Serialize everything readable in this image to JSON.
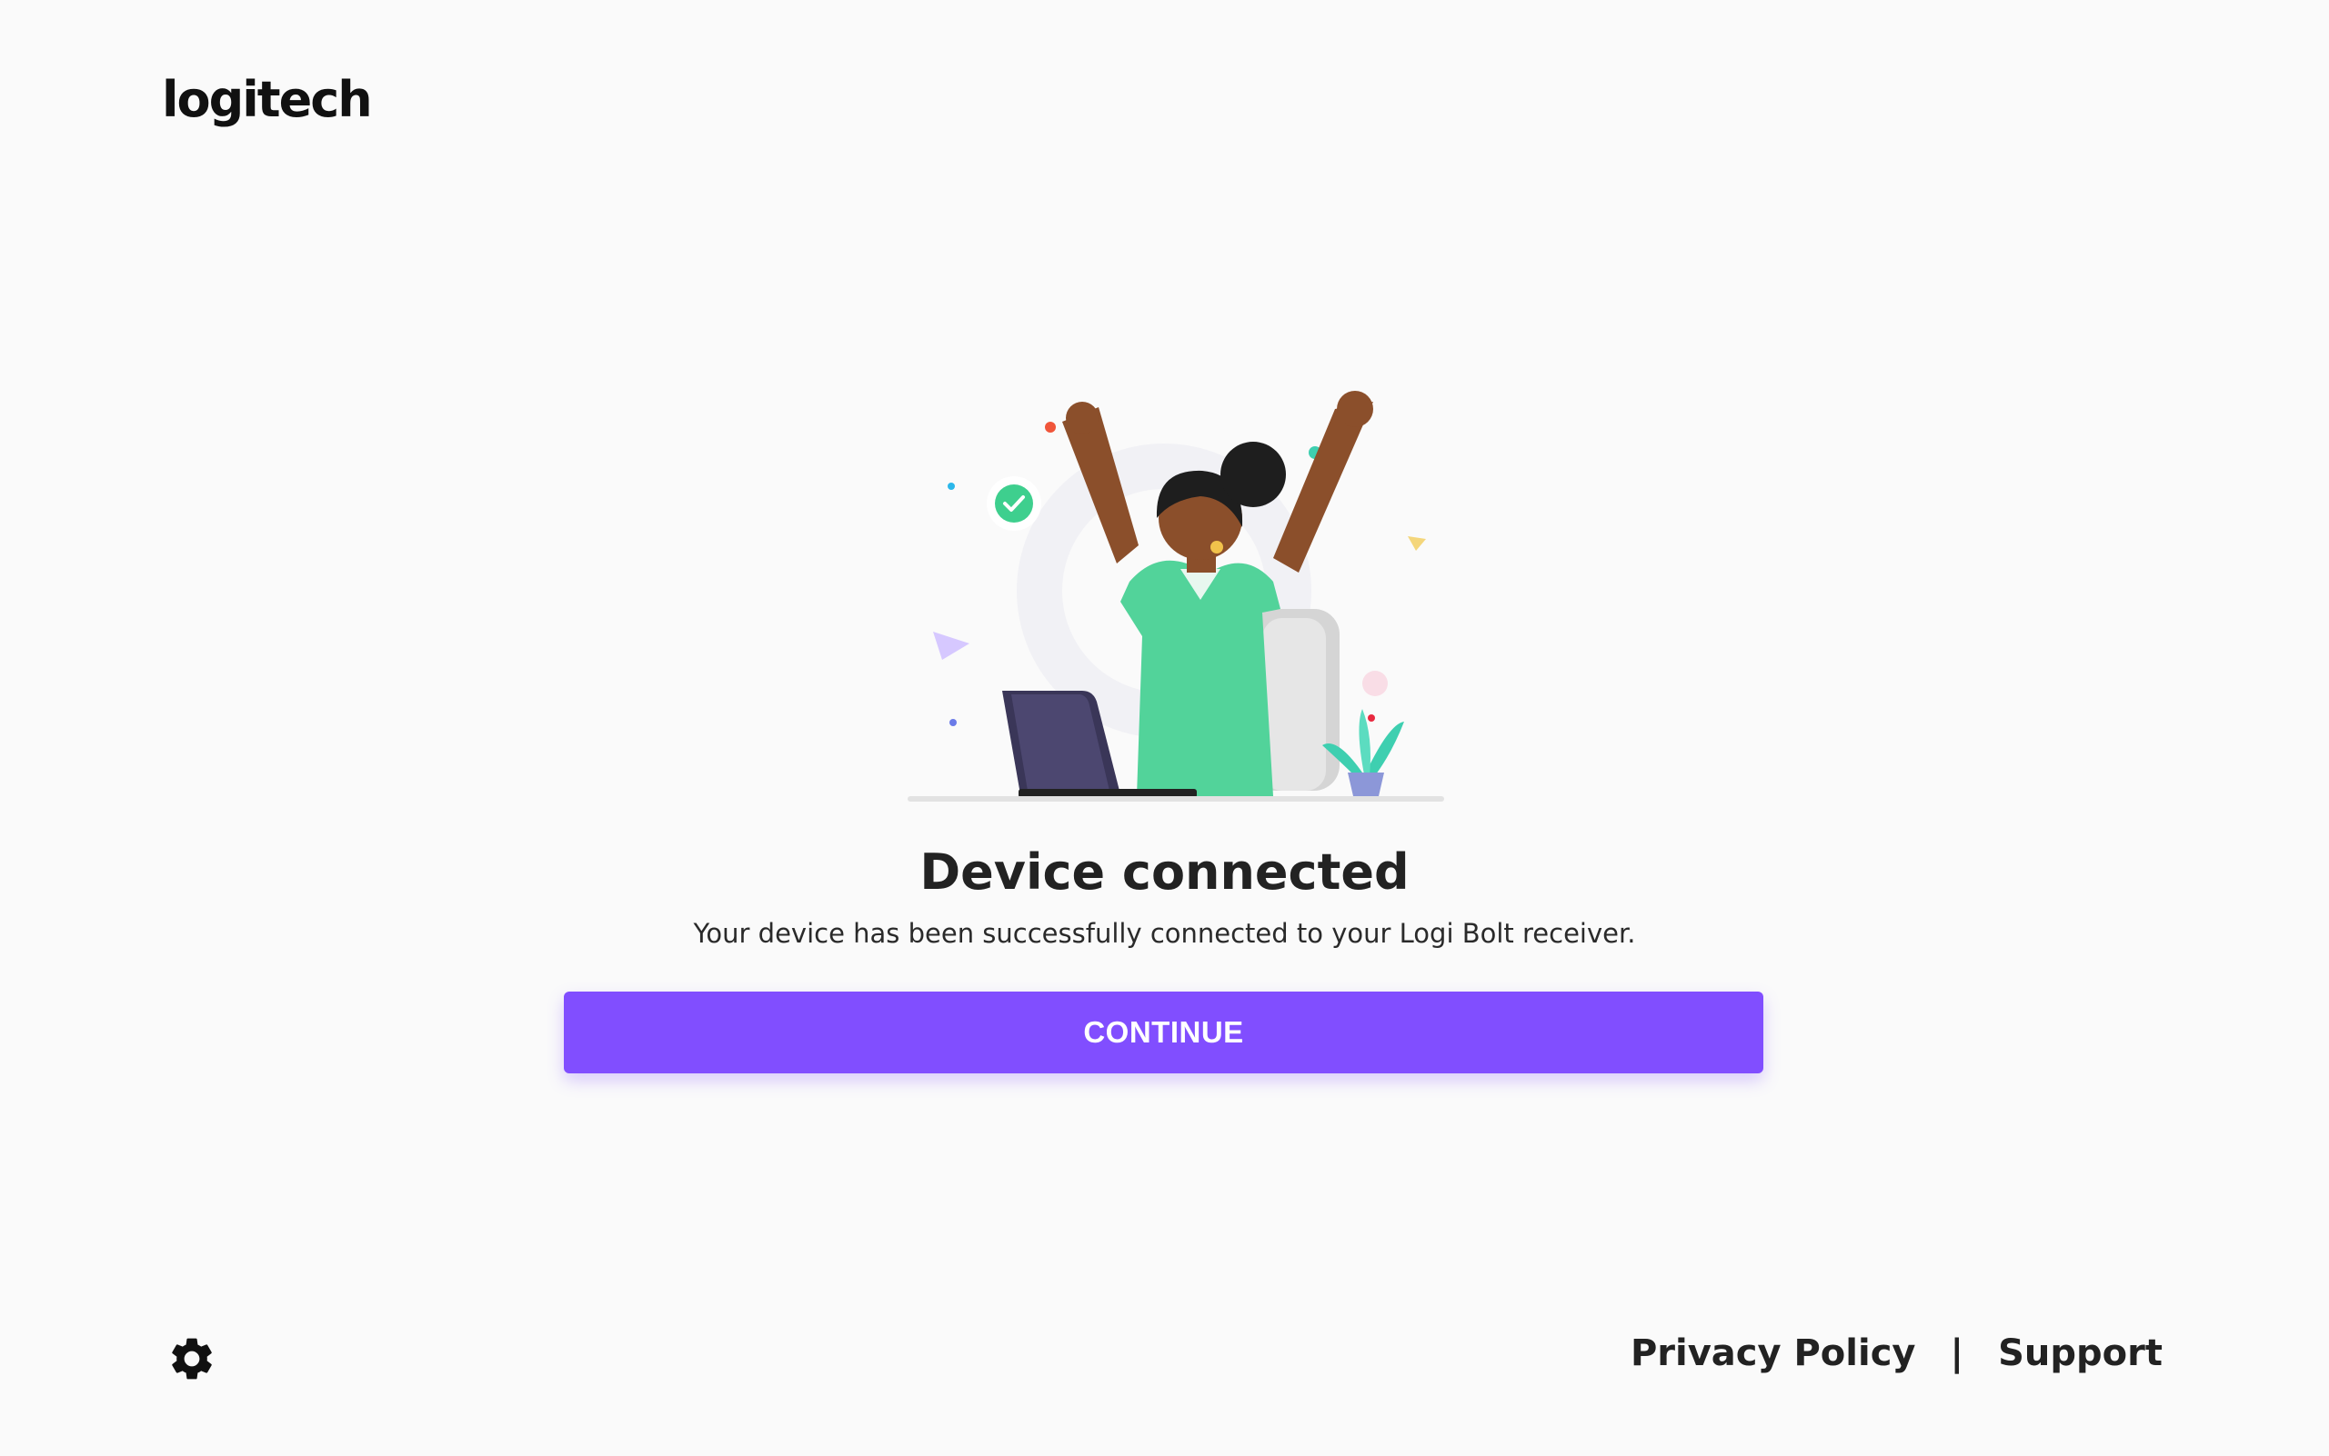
{
  "brand": {
    "logo_text": "logitech"
  },
  "main": {
    "title": "Device connected",
    "subtitle": "Your device has been successfully connected to your Logi Bolt receiver.",
    "continue_label": "CONTINUE"
  },
  "footer": {
    "settings_icon": "gear-icon",
    "privacy_label": "Privacy Policy",
    "separator": "|",
    "support_label": "Support"
  },
  "colors": {
    "accent": "#814eff",
    "background": "#fafafa",
    "text": "#222222",
    "shirt": "#52d39a",
    "check": "#3ecf8e"
  }
}
